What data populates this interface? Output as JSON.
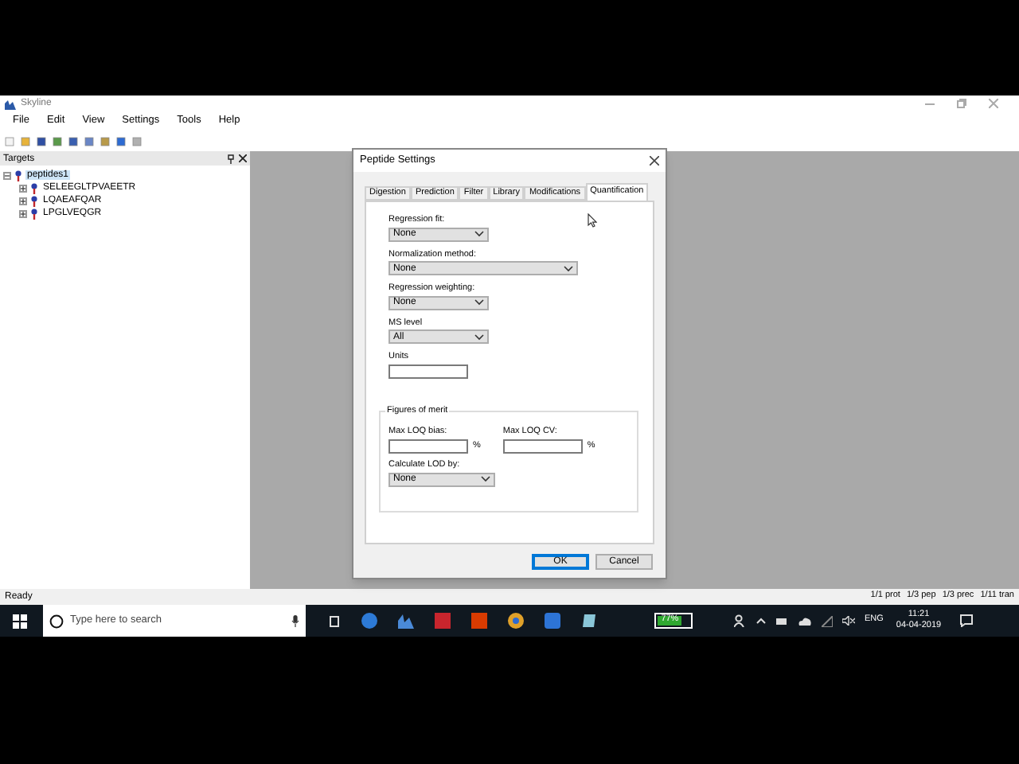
{
  "window": {
    "title": "Skyline"
  },
  "menu": [
    "File",
    "Edit",
    "View",
    "Settings",
    "Tools",
    "Help"
  ],
  "targets": {
    "title": "Targets",
    "tree": [
      {
        "label": "peptides1",
        "expanded": true,
        "selected": true,
        "children": [
          {
            "label": "SELEEGLTPVAEETR",
            "expanded": false,
            "selected": false
          },
          {
            "label": "LQAEAFQAR",
            "expanded": false,
            "selected": false
          },
          {
            "label": "LPGLVEQGR",
            "expanded": false,
            "selected": false
          }
        ]
      }
    ]
  },
  "dialog": {
    "title": "Peptide Settings",
    "tabs": [
      {
        "label": "Digestion",
        "selected": false
      },
      {
        "label": "Prediction",
        "selected": false
      },
      {
        "label": "Filter",
        "selected": false
      },
      {
        "label": "Library",
        "selected": false
      },
      {
        "label": "Modifications",
        "selected": false
      },
      {
        "label": "Quantification",
        "selected": true
      }
    ],
    "fields": [
      {
        "kind": "select",
        "label": "Regression fit:",
        "value": "None",
        "wide": false
      },
      {
        "kind": "select",
        "label": "Normalization method:",
        "value": "None",
        "wide": true
      },
      {
        "kind": "select",
        "label": "Regression weighting:",
        "value": "None",
        "wide": false
      },
      {
        "kind": "select",
        "label": "MS level",
        "value": "All",
        "wide": false
      },
      {
        "kind": "text",
        "label": "Units"
      }
    ],
    "group": {
      "title": "Figures of merit",
      "pct_fields": [
        {
          "label": "Max LOQ bias:",
          "unit": "%"
        },
        {
          "label": "Max LOQ CV:",
          "unit": "%"
        }
      ],
      "lod": {
        "label": "Calculate LOD by:",
        "value": "None"
      }
    },
    "buttons": [
      {
        "label": "OK",
        "default": true
      },
      {
        "label": "Cancel",
        "default": false
      }
    ]
  },
  "status_bar": {
    "message": "Ready",
    "counts": [
      "1/1 prot",
      "1/3 pep",
      "1/3 prec",
      "1/11 tran"
    ]
  },
  "taskbar": {
    "search_placeholder": "Type here to search",
    "battery": {
      "level": 0.77,
      "text": "77%"
    },
    "language": "ENG",
    "time": "11:21",
    "date": "04-04-2019"
  }
}
